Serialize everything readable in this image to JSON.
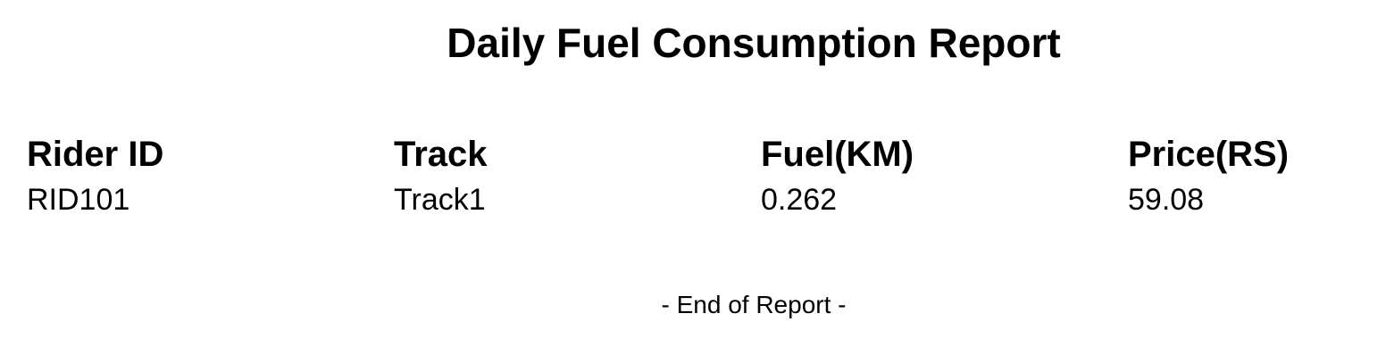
{
  "report": {
    "title": "Daily Fuel Consumption Report",
    "columns": [
      "Rider ID",
      "Track",
      "Fuel(KM)",
      "Price(RS)"
    ],
    "rows": [
      [
        "RID101",
        "Track1",
        "0.262",
        "59.08"
      ]
    ],
    "footer": "- End of Report -"
  }
}
